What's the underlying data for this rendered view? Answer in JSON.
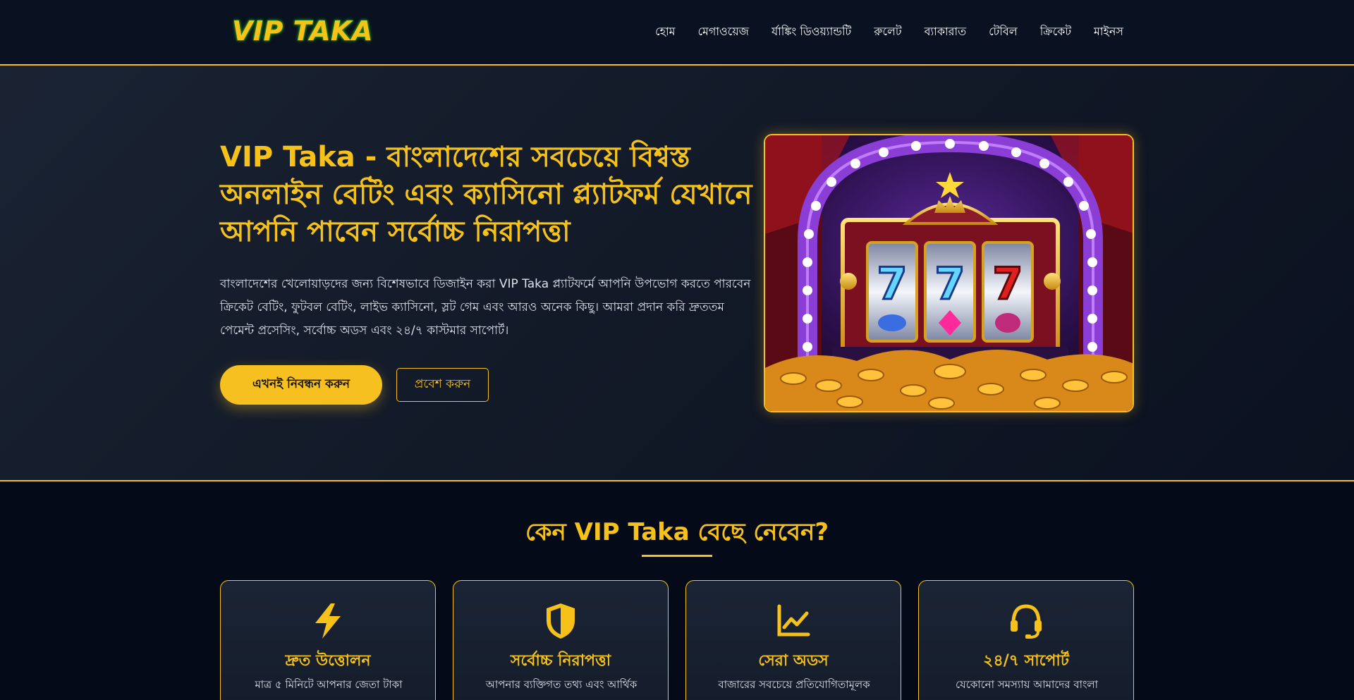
{
  "header": {
    "logo": "VIP TAKA",
    "nav": [
      "হোম",
      "মেগাওয়েজ",
      "র্যাঙ্কিং ডিওয়্যান্ডটি",
      "রুলেট",
      "ব্যাকারাত",
      "টেবিল",
      "ক্রিকেট",
      "মাইনস"
    ]
  },
  "hero": {
    "title": "VIP Taka - বাংলাদেশের সবচেয়ে বিশ্বস্ত অনলাইন বেটিং এবং ক্যাসিনো প্ল্যাটফর্ম যেখানে আপনি পাবেন সর্বোচ্চ নিরাপত্তা",
    "description": "বাংলাদেশের খেলোয়াড়দের জন্য বিশেষভাবে ডিজাইন করা VIP Taka প্ল্যাটফর্মে আপনি উপভোগ করতে পারবেন ক্রিকেট বেটিং, ফুটবল বেটিং, লাইভ ক্যাসিনো, স্লট গেম এবং আরও অনেক কিছু। আমরা প্রদান করি দ্রুততম পেমেন্ট প্রসেসিং, সর্বোচ্চ অডস এবং ২৪/৭ কাস্টমার সাপোর্ট।",
    "register_label": "এখনই নিবন্ধন করুন",
    "login_label": "প্রবেশ করুন",
    "image_icon": "slot-machine-image"
  },
  "why": {
    "title": "কেন VIP Taka বেছে নেবেন?",
    "cards": [
      {
        "icon": "lightning-icon",
        "title": "দ্রুত উত্তোলন",
        "text": "মাত্র ৫ মিনিটে আপনার জেতা টাকা"
      },
      {
        "icon": "shield-icon",
        "title": "সর্বোচ্চ নিরাপত্তা",
        "text": "আপনার ব্যক্তিগত তথ্য এবং আর্থিক"
      },
      {
        "icon": "chart-icon",
        "title": "সেরা অডস",
        "text": "বাজারের সবচেয়ে প্রতিযোগিতামূলক"
      },
      {
        "icon": "headset-icon",
        "title": "২৪/৭ সাপোর্ট",
        "text": "যেকোনো সমস্যায় আমাদের বাংলা"
      }
    ]
  },
  "colors": {
    "accent": "#f6c21a",
    "background": "#050a18",
    "hero_bg": "#141c2b"
  }
}
